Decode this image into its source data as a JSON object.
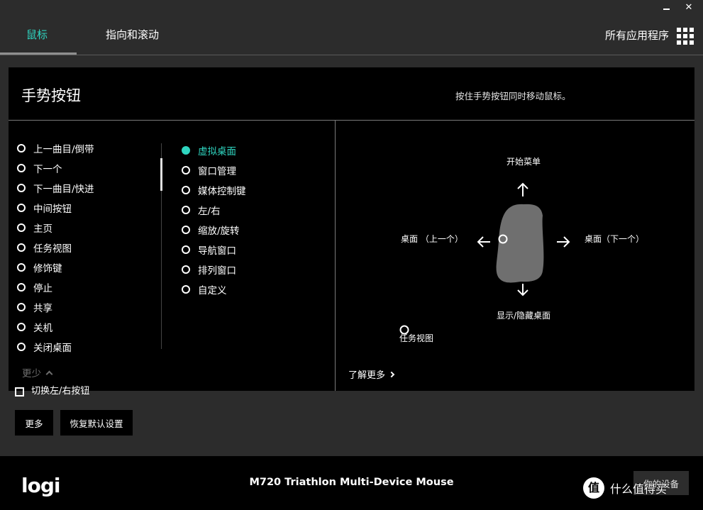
{
  "window": {
    "minimize": "–",
    "close": "✕"
  },
  "nav": {
    "tabs": [
      {
        "label": "鼠标",
        "active": true
      },
      {
        "label": "指向和滚动",
        "active": false
      }
    ],
    "all_apps_label": "所有应用程序"
  },
  "panel": {
    "title": "手势按钮",
    "hint": "按住手势按钮同时移动鼠标。",
    "left_options": [
      "上一曲目/倒带",
      "下一个",
      "下一曲目/快进",
      "中间按钮",
      "主页",
      "任务视图",
      "修饰键",
      "停止",
      "共享",
      "关机",
      "关闭桌面"
    ],
    "right_options": [
      {
        "label": "虚拟桌面",
        "selected": true
      },
      {
        "label": "窗口管理",
        "selected": false
      },
      {
        "label": "媒体控制键",
        "selected": false
      },
      {
        "label": "左/右",
        "selected": false
      },
      {
        "label": "缩放/旋转",
        "selected": false
      },
      {
        "label": "导航窗口",
        "selected": false
      },
      {
        "label": "排列窗口",
        "selected": false
      },
      {
        "label": "自定义",
        "selected": false
      }
    ],
    "less_label": "更少",
    "diagram": {
      "up": "开始菜单",
      "left": "桌面 （上一个）",
      "right": "桌面（下一个）",
      "down": "显示/隐藏桌面",
      "click": "任务视图"
    },
    "learn_more": "了解更多"
  },
  "swap_label": "切换左/右按钮",
  "buttons": {
    "more": "更多",
    "reset": "恢复默认设置"
  },
  "footer": {
    "logo": "logi",
    "device_name": "M720 Triathlon Multi-Device Mouse",
    "your_devices": "你的设备",
    "watermark": "值 什么值得买"
  },
  "colors": {
    "accent": "#2fd5c0",
    "background": "#2c2c2c",
    "panel": "#000000",
    "mouse_body": "#6f6f6f"
  }
}
